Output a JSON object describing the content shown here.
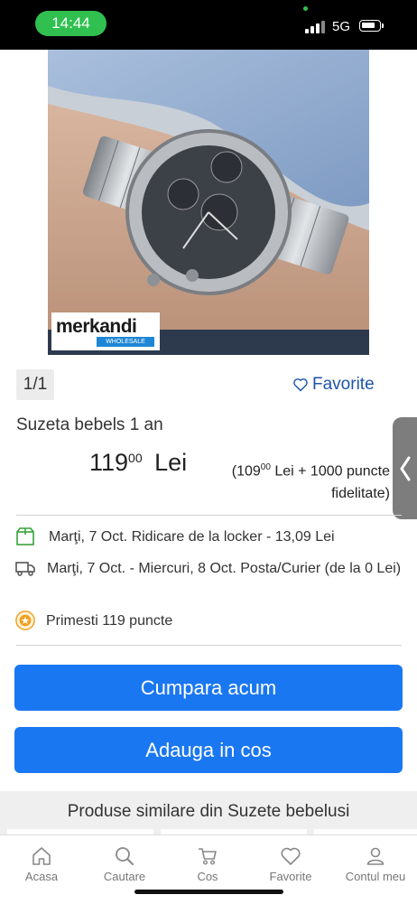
{
  "status_bar": {
    "time": "14:44",
    "network": "5G"
  },
  "gallery": {
    "counter": "1/1",
    "watermark_text": "merkandi",
    "watermark_sub": "WHOLESALE"
  },
  "favorite_label": "Favorite",
  "product": {
    "title": "Suzeta bebels 1 an",
    "price_int": "119",
    "price_dec": "00",
    "currency": "Lei",
    "loyalty_open": "(109",
    "loyalty_dec": "00",
    "loyalty_rest": " Lei + 1000 puncte",
    "loyalty_line2": "fidelitate)"
  },
  "delivery": {
    "locker": "Marţi, 7 Oct. Ridicare de la locker - 13,09 Lei",
    "courier": "Marţi, 7 Oct. - Miercuri, 8 Oct. Posta/Curier (de la 0 Lei)",
    "points": "Primesti 119 puncte"
  },
  "buttons": {
    "buy_now": "Cumpara acum",
    "add_to_cart": "Adauga in cos"
  },
  "similar": {
    "title": "Produse similare din Suzete bebelusi"
  },
  "nav": [
    {
      "label": "Acasa",
      "icon": "home-icon"
    },
    {
      "label": "Cautare",
      "icon": "search-icon"
    },
    {
      "label": "Cos",
      "icon": "cart-icon"
    },
    {
      "label": "Favorite",
      "icon": "heart-icon"
    },
    {
      "label": "Contul meu",
      "icon": "user-icon"
    }
  ],
  "colors": {
    "primary": "#1a77f2",
    "link": "#1e55a8",
    "status_green": "#30c04f",
    "box_green": "#3aa13a",
    "points_orange": "#f0a020"
  }
}
